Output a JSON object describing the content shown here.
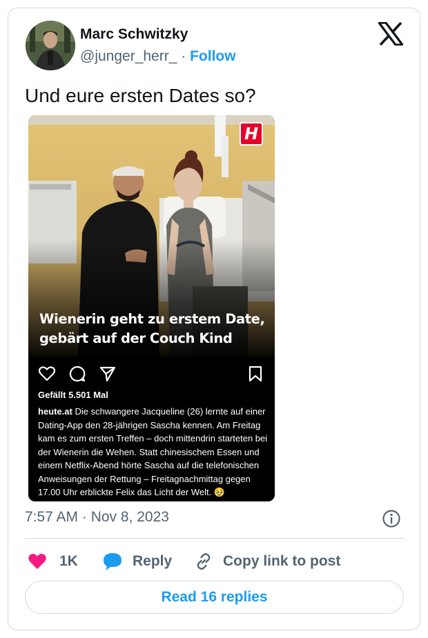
{
  "author": {
    "name": "Marc Schwitzky",
    "handle": "@junger_herr_",
    "separator": " · ",
    "follow_label": "Follow"
  },
  "tweet": {
    "text": "Und eure ersten Dates so?",
    "timestamp": "7:57 AM · Nov 8, 2023"
  },
  "media": {
    "brand_badge": "H",
    "headline_line1": "Wienerin geht zu erstem Date,",
    "headline_line2": "gebärt auf der Couch Kind",
    "likes": "Gefällt 5.501 Mal",
    "caption_account": "heute.at",
    "caption_text": " Die schwangere Jacqueline (26) lernte auf einer Dating-App den 28-jährigen Sascha kennen. Am Freitag kam es zum ersten Treffen – doch mittendrin starteten bei der Wienerin die Wehen. Statt chinesischem Essen und einem Netflix-Abend hörte Sascha auf die telefonischen Anweisungen der Rettung – Freitagnachmittag gegen 17.00 Uhr erblickte Felix das Licht der Welt. 🥹"
  },
  "actions": {
    "likes_count": "1K",
    "reply_label": "Reply",
    "copy_label": "Copy link to post"
  },
  "read_replies_label": "Read 16 replies",
  "colors": {
    "accent": "#1d9bf0",
    "heart": "#f91880",
    "muted": "#536471",
    "border": "#cfd9de",
    "badge": "#e4002b"
  },
  "icons": [
    "x-logo-icon",
    "heart-icon",
    "comment-icon",
    "send-icon",
    "bookmark-icon",
    "info-icon",
    "reply-bubble-icon",
    "link-icon"
  ]
}
